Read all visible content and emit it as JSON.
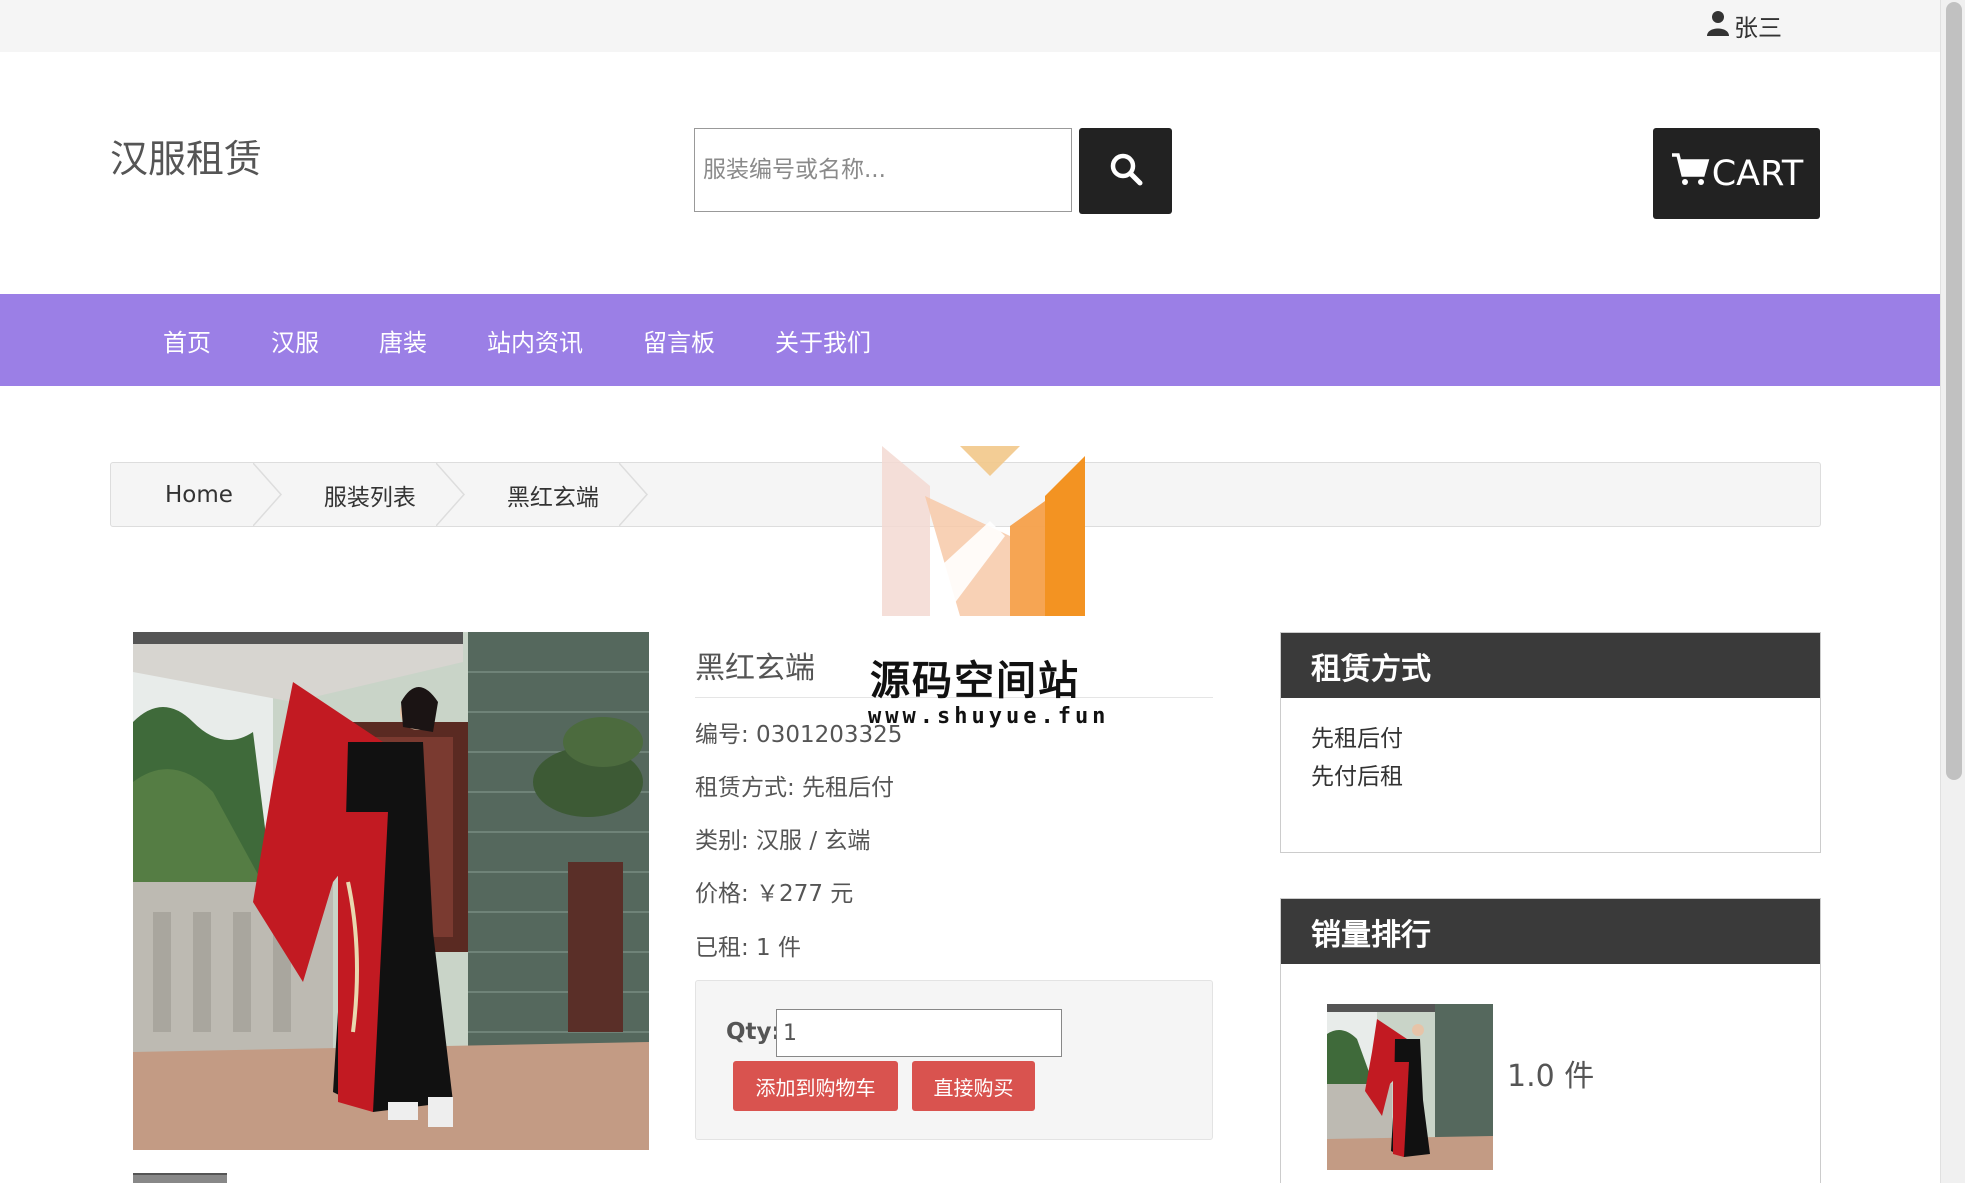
{
  "topbar": {
    "user_name": "张三"
  },
  "header": {
    "brand": "汉服租赁",
    "search_placeholder": "服装编号或名称...",
    "cart_label": "CART"
  },
  "nav": {
    "items": [
      "首页",
      "汉服",
      "唐装",
      "站内资讯",
      "留言板",
      "关于我们"
    ]
  },
  "breadcrumb": [
    "Home",
    "服装列表",
    "黑红玄端"
  ],
  "product": {
    "title": "黑红玄端",
    "code": "编号: 0301203325",
    "rent_mode": "租赁方式: 先租后付",
    "category": "类别: 汉服 / 玄端",
    "price": "价格: ￥277 元",
    "rented": "已租: 1 件",
    "qty_label": "Qty:",
    "qty_value": "1",
    "add_cart_label": "添加到购物车",
    "buy_now_label": "直接购买"
  },
  "sidebar": {
    "rent_panel": {
      "title": "租赁方式",
      "options": [
        "先租后付",
        "先付后租"
      ]
    },
    "rank_panel": {
      "title": "销量排行",
      "items": [
        {
          "count": "1.0 件"
        }
      ]
    }
  },
  "watermark": {
    "title": "源码空间站",
    "url": "www.shuyue.fun"
  },
  "colors": {
    "nav_bg": "#9b7fe6",
    "dark": "#222222",
    "danger": "#d9534f",
    "panel_head": "#3a3a3a"
  }
}
